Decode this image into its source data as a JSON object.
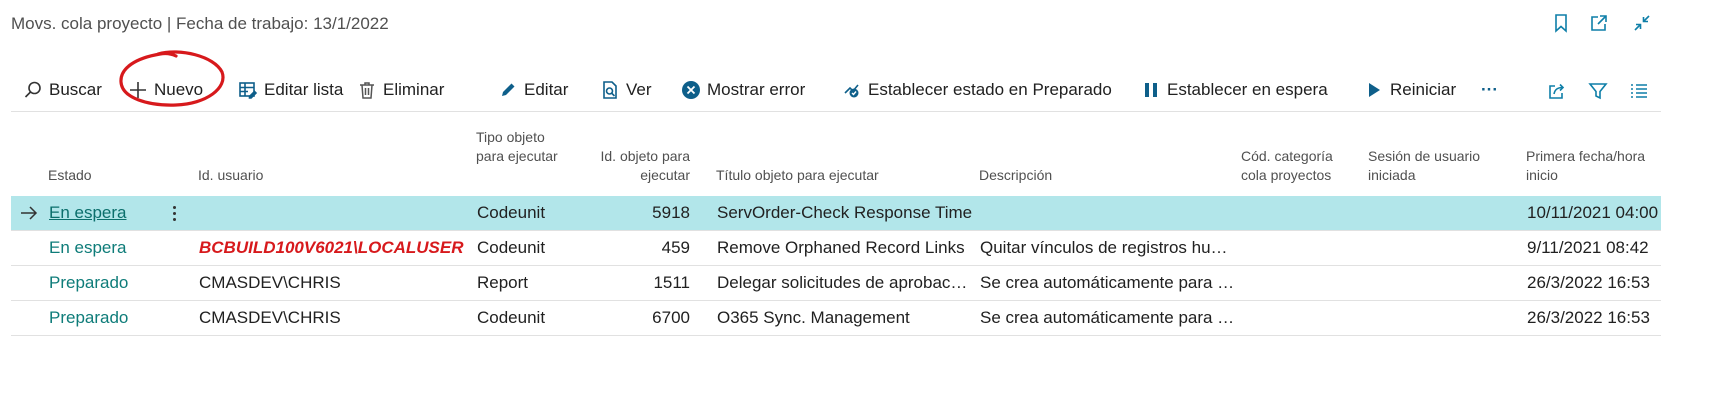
{
  "header": {
    "title": "Movs. cola proyecto | Fecha de trabajo: 13/1/2022"
  },
  "toolbar": {
    "search": "Buscar",
    "new": "Nuevo",
    "edit_list": "Editar lista",
    "delete": "Eliminar",
    "edit": "Editar",
    "view": "Ver",
    "show_error": "Mostrar error",
    "set_ready": "Establecer estado en Preparado",
    "set_on_hold": "Establecer en espera",
    "restart": "Reiniciar",
    "more": "···"
  },
  "columns": {
    "estado": "Estado",
    "usuario": "Id. usuario",
    "tipo": "Tipo objeto para ejecutar",
    "id_objeto": "Id. objeto para ejecutar",
    "titulo": "Título objeto para ejecutar",
    "descripcion": "Descripción",
    "categoria": "Cód. categoría cola proyectos",
    "sesion": "Sesión de usuario iniciada",
    "fecha": "Primera fecha/hora inicio"
  },
  "rows": [
    {
      "estado": "En espera",
      "usuario": "",
      "tipo": "Codeunit",
      "id_objeto": "5918",
      "titulo": "ServOrder-Check Response Time",
      "descripcion": "",
      "categoria": "",
      "sesion": "",
      "fecha": "10/11/2021 04:00"
    },
    {
      "estado": "En espera",
      "usuario": "BCBUILD100V6021\\LOCALUSER",
      "tipo": "Codeunit",
      "id_objeto": "459",
      "titulo": "Remove Orphaned Record Links",
      "descripcion": "Quitar vínculos de registros hu…",
      "categoria": "",
      "sesion": "",
      "fecha": "9/11/2021 08:42"
    },
    {
      "estado": "Preparado",
      "usuario": "CMASDEV\\CHRIS",
      "tipo": "Report",
      "id_objeto": "1511",
      "titulo": "Delegar solicitudes de aprobac…",
      "descripcion": "Se crea automáticamente para …",
      "categoria": "",
      "sesion": "",
      "fecha": "26/3/2022 16:53"
    },
    {
      "estado": "Preparado",
      "usuario": "CMASDEV\\CHRIS",
      "tipo": "Codeunit",
      "id_objeto": "6700",
      "titulo": "O365 Sync. Management",
      "descripcion": "Se crea automáticamente para …",
      "categoria": "",
      "sesion": "",
      "fecha": "26/3/2022 16:53"
    }
  ],
  "colors": {
    "accent": "#0e7fa8",
    "link": "#0e7c79",
    "selected_row": "#b2e6ea",
    "annotation": "#d7191c"
  }
}
